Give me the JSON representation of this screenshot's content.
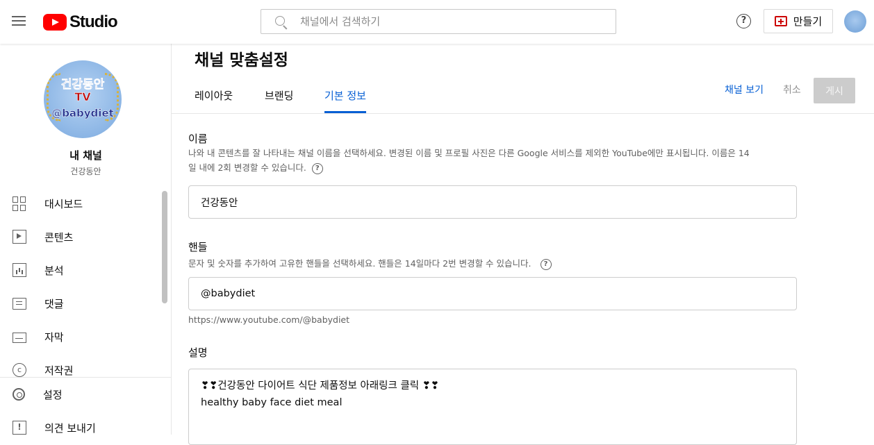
{
  "topbar": {
    "logo_text": "Studio",
    "search_placeholder": "채널에서 검색하기",
    "help_glyph": "?",
    "create_label": "만들기"
  },
  "icons": {
    "menu": "hamburger-menu-icon",
    "search": "search-icon",
    "help": "help-circle-icon",
    "create": "video-plus-icon",
    "dashboard": "dashboard-grid-icon",
    "content": "play-box-icon",
    "analytics": "bar-chart-icon",
    "comments": "comment-icon",
    "subtitles": "subtitles-icon",
    "copyright": "copyright-icon",
    "settings": "gear-icon",
    "feedback": "feedback-icon"
  },
  "colors": {
    "brand_red": "#ff0000",
    "link_blue": "#065fd4",
    "disabled_button": "#cccccc"
  },
  "sidebar": {
    "avatar_text": {
      "line1": "건강동안",
      "line2": "TV",
      "line3": "@babydiet"
    },
    "my_channel": "내 채널",
    "channel_name": "건강동안",
    "items": [
      {
        "label": "대시보드"
      },
      {
        "label": "콘텐츠"
      },
      {
        "label": "분석"
      },
      {
        "label": "댓글"
      },
      {
        "label": "자막"
      },
      {
        "label": "저작권"
      }
    ],
    "bottom_items": [
      {
        "label": "설정"
      },
      {
        "label": "의견 보내기"
      }
    ],
    "copyright_glyph": "c",
    "feedback_glyph": "!"
  },
  "main": {
    "title": "채널 맞춤설정",
    "tabs": [
      {
        "label": "레이아웃",
        "active": false
      },
      {
        "label": "브랜딩",
        "active": false
      },
      {
        "label": "기본 정보",
        "active": true
      }
    ],
    "view_channel": "채널 보기",
    "cancel": "취소",
    "publish": "게시",
    "help_glyph": "?",
    "name_section": {
      "title": "이름",
      "description_line1": "나와 내 콘텐츠를 잘 나타내는 채널 이름을 선택하세요. 변경된 이름 및 프로필 사진은 다른 Google 서비스를 제외한 YouTube에만 표시됩니다. 이름은 14",
      "description_line2": "일 내에 2회 변경할 수 있습니다.",
      "value": "건강동안"
    },
    "handle_section": {
      "title": "핸들",
      "description": "문자 및 숫자를 추가하여 고유한 핸들을 선택하세요. 핸들은 14일마다 2번 변경할 수 있습니다.",
      "value": "@babydiet",
      "url": "https://www.youtube.com/@babydiet"
    },
    "description_section": {
      "title": "설명",
      "line1": "❣❣건강동안 다이어트 식단 제품정보 아래링크 클릭 ❣❣",
      "line2": "healthy baby face diet meal"
    }
  }
}
